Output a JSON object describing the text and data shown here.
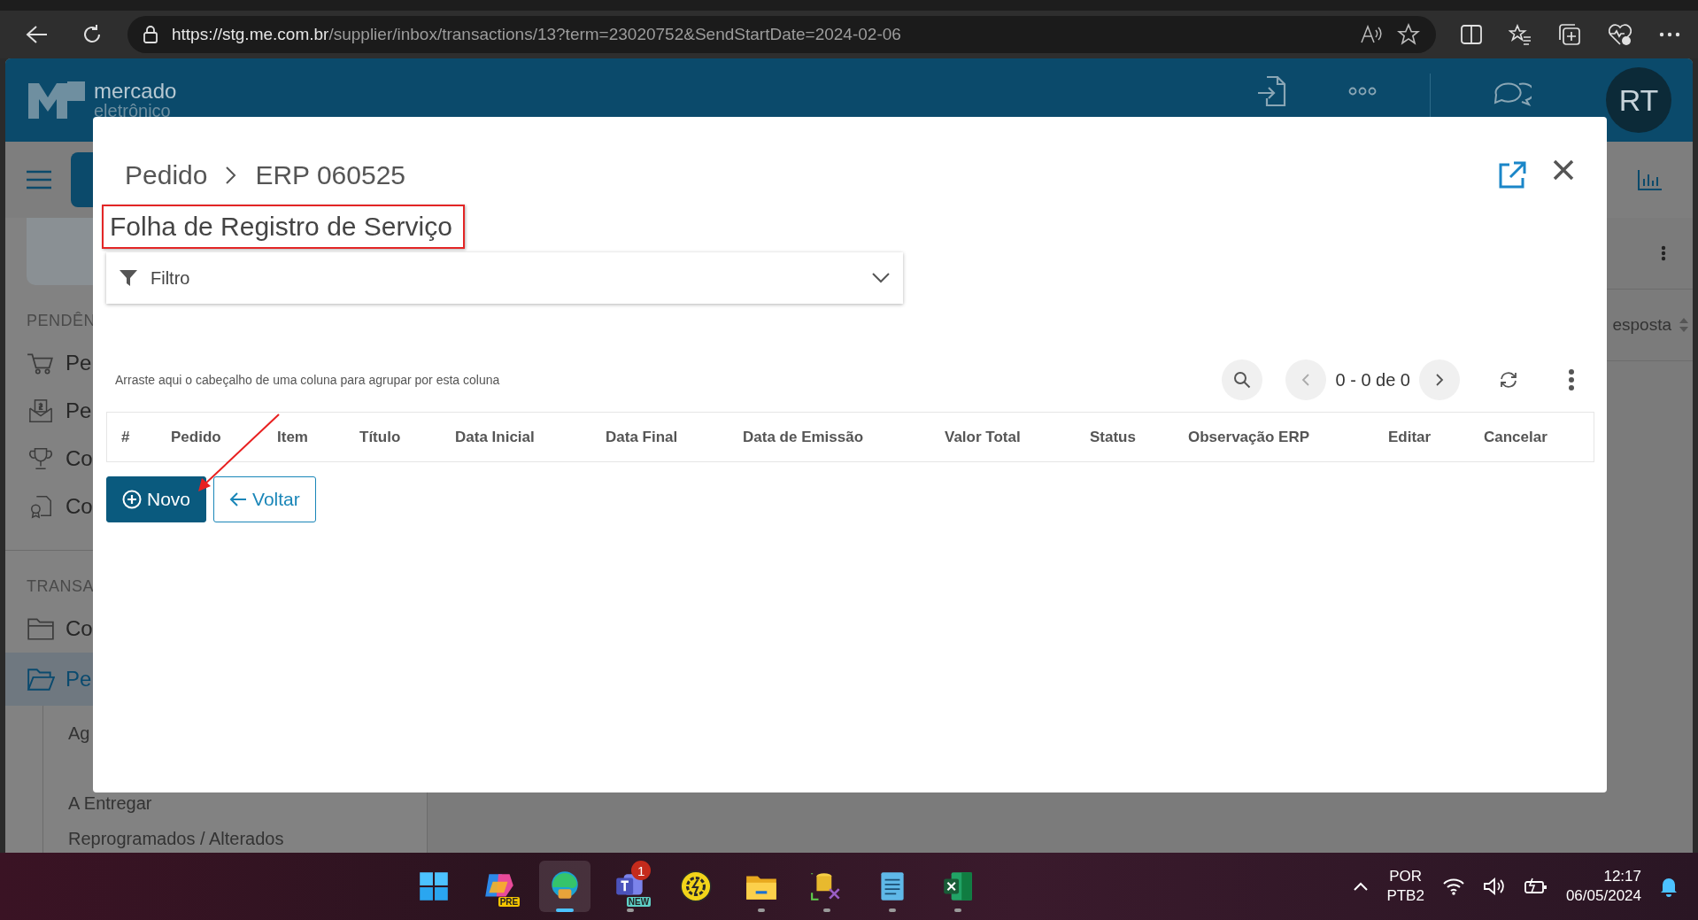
{
  "browser": {
    "url_host": "https://stg.me.com.br",
    "url_path": "/supplier/inbox/transactions/13?term=23020752&SendStartDate=2024-02-06"
  },
  "app_header": {
    "logo_text": "mercado",
    "logo_subtext": "eletrônico",
    "avatar": "RT"
  },
  "sidebar": {
    "sections": [
      {
        "title": "PENDÊN",
        "items": [
          {
            "label": "Pe",
            "kind": "cart",
            "selected": false
          },
          {
            "label": "Pe",
            "kind": "money",
            "selected": false
          },
          {
            "label": "Co",
            "kind": "trophy",
            "selected": false
          },
          {
            "label": "Co",
            "kind": "certificate",
            "selected": false
          }
        ]
      },
      {
        "title": "TRANSA",
        "items": [
          {
            "label": "Co",
            "kind": "folder",
            "selected": false
          },
          {
            "label": "Pe",
            "kind": "folder-open",
            "selected": true,
            "children": [
              {
                "label": "Ag"
              },
              {
                "label": "A Entregar"
              },
              {
                "label": "Reprogramados / Alterados"
              }
            ]
          }
        ]
      }
    ]
  },
  "background_table": {
    "column_header": "esposta"
  },
  "modal": {
    "breadcrumb": [
      "Pedido",
      "ERP 060525"
    ],
    "title": "Folha de Registro de Serviço",
    "title_highlighted": true,
    "pointer_arrow": true,
    "filter": {
      "label": "Filtro",
      "expanded": false
    },
    "group_hint": "Arraste aqui o cabeçalho de uma coluna para agrupar por esta coluna",
    "pager": "0 - 0 de 0",
    "columns": [
      "#",
      "Pedido",
      "Item",
      "Título",
      "Data Inicial",
      "Data Final",
      "Data de Emissão",
      "Valor Total",
      "Status",
      "Observação ERP",
      "Editar",
      "Cancelar"
    ],
    "buttons": [
      {
        "label": "Novo",
        "kind": "primary"
      },
      {
        "label": "Voltar",
        "kind": "secondary"
      }
    ]
  },
  "taskbar": {
    "apps": [
      {
        "kind": "windows",
        "selected": false,
        "running": false
      },
      {
        "kind": "copilot",
        "tag": "PRE",
        "selected": false,
        "running": false
      },
      {
        "kind": "edge",
        "selected": true,
        "running": true
      },
      {
        "kind": "teams",
        "tag": "NEW",
        "badge": "1",
        "selected": false,
        "running": true
      },
      {
        "kind": "gear",
        "selected": false,
        "running": false
      },
      {
        "kind": "folder",
        "selected": false,
        "running": true
      },
      {
        "kind": "database",
        "selected": false,
        "running": true
      },
      {
        "kind": "notepad",
        "selected": false,
        "running": true
      },
      {
        "kind": "excel",
        "selected": false,
        "running": true
      }
    ],
    "language": "POR",
    "layout": "PTB2",
    "time": "12:17",
    "date": "06/05/2024"
  }
}
